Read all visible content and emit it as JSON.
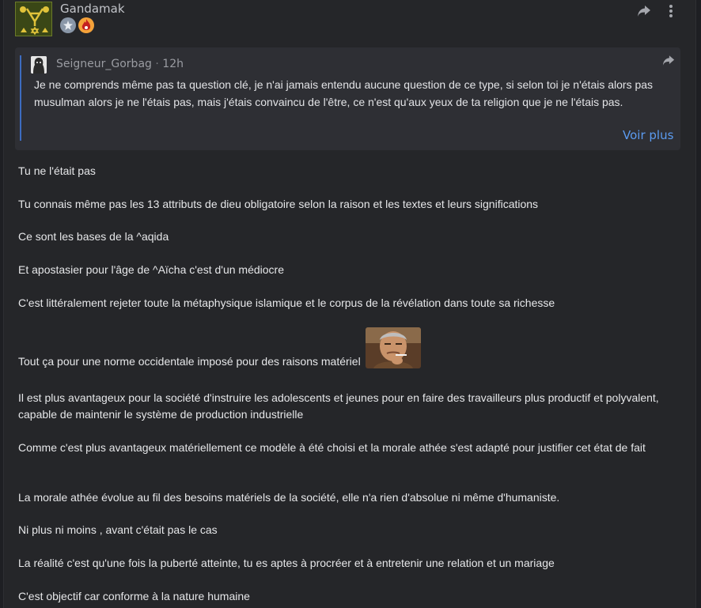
{
  "author": {
    "name": "Gandamak"
  },
  "quote": {
    "author": "Seigneur_Gorbag",
    "separator": "·",
    "time": "12h",
    "text": "Je ne comprends même pas ta question clé, je n'ai jamais entendu aucune question de ce type, si selon toi je n'étais alors pas musulman alors je ne l'étais pas, mais j'étais convaincu de l'être, ce n'est qu'aux yeux de ta religion que je ne l'étais pas.",
    "more_label": "Voir plus"
  },
  "body": {
    "p1": "Tu ne l'était pas",
    "p2": "Tu connais même pas les 13 attributs de dieu obligatoire selon la raison et les textes et leurs significations",
    "p3": "Ce sont les bases de la ^aqida",
    "p4": "Et apostasier pour l'âge de ^Aïcha c'est d'un médiocre",
    "p5": "C'est littéralement rejeter toute la métaphysique islamique et le corpus de la révélation dans toute sa richesse",
    "p6": "Tout ça pour une norme occidentale imposé pour des raisons matériel",
    "p7": "Il est plus avantageux pour la société d'instruire les adolescents et jeunes pour en faire des travailleurs plus productif et polyvalent, capable de maintenir le système de production industrielle",
    "p8": "Comme c'est plus avantageux matériellement ce modèle à été choisi et la morale athée s'est adapté pour justifier cet état de fait",
    "p9": "La morale athée évolue au fil des besoins matériels de la société, elle n'a rien d'absolue ni même d'humaniste.",
    "p10": "Ni plus ni moins , avant c'était pas le cas",
    "p11": "La réalité c'est qu'une fois la puberté atteinte, tu es aptes à procréer et à entretenir une relation et un mariage",
    "p12": "C'est objectif car conforme à la nature humaine"
  },
  "icons": {
    "share": "share-arrow-icon",
    "more": "more-vertical-icon",
    "badge1": "silver-badge-icon",
    "badge2": "fire-badge-icon",
    "sticker": "man-smoking-sticker"
  },
  "colors": {
    "background": "#252629",
    "quote_bg": "#2e2f34",
    "quote_bar": "#3d6cc0",
    "link": "#5b9bf0"
  }
}
